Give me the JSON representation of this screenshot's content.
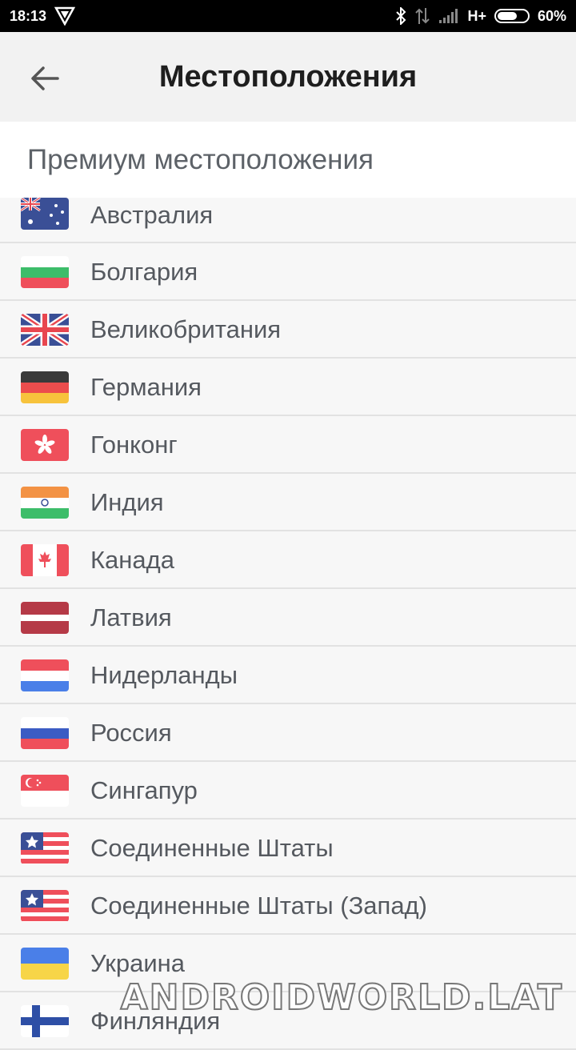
{
  "status_bar": {
    "time": "18:13",
    "network": "H+",
    "battery": "60%",
    "icons": [
      "vpn-shield-icon",
      "bluetooth-icon",
      "data-arrows-icon",
      "signal-icon",
      "battery-icon"
    ]
  },
  "header": {
    "title": "Местоположения",
    "back_icon": "arrow-left-icon"
  },
  "section": {
    "title": "Премиум местоположения"
  },
  "locations": [
    {
      "label": "Австралия",
      "flag": "flag-australia-icon"
    },
    {
      "label": "Болгария",
      "flag": "flag-bulgaria-icon"
    },
    {
      "label": "Великобритания",
      "flag": "flag-uk-icon"
    },
    {
      "label": "Германия",
      "flag": "flag-germany-icon"
    },
    {
      "label": "Гонконг",
      "flag": "flag-hongkong-icon"
    },
    {
      "label": "Индия",
      "flag": "flag-india-icon"
    },
    {
      "label": "Канада",
      "flag": "flag-canada-icon"
    },
    {
      "label": "Латвия",
      "flag": "flag-latvia-icon"
    },
    {
      "label": "Нидерланды",
      "flag": "flag-netherlands-icon"
    },
    {
      "label": "Россия",
      "flag": "flag-russia-icon"
    },
    {
      "label": "Сингапур",
      "flag": "flag-singapore-icon"
    },
    {
      "label": "Соединенные Штаты",
      "flag": "flag-usa-icon"
    },
    {
      "label": "Соединенные Штаты (Запад)",
      "flag": "flag-usa-icon"
    },
    {
      "label": "Украина",
      "flag": "flag-ukraine-icon"
    },
    {
      "label": "Финляндия",
      "flag": "flag-finland-icon"
    }
  ],
  "watermark": "ANDROIDWORLD.LAT"
}
